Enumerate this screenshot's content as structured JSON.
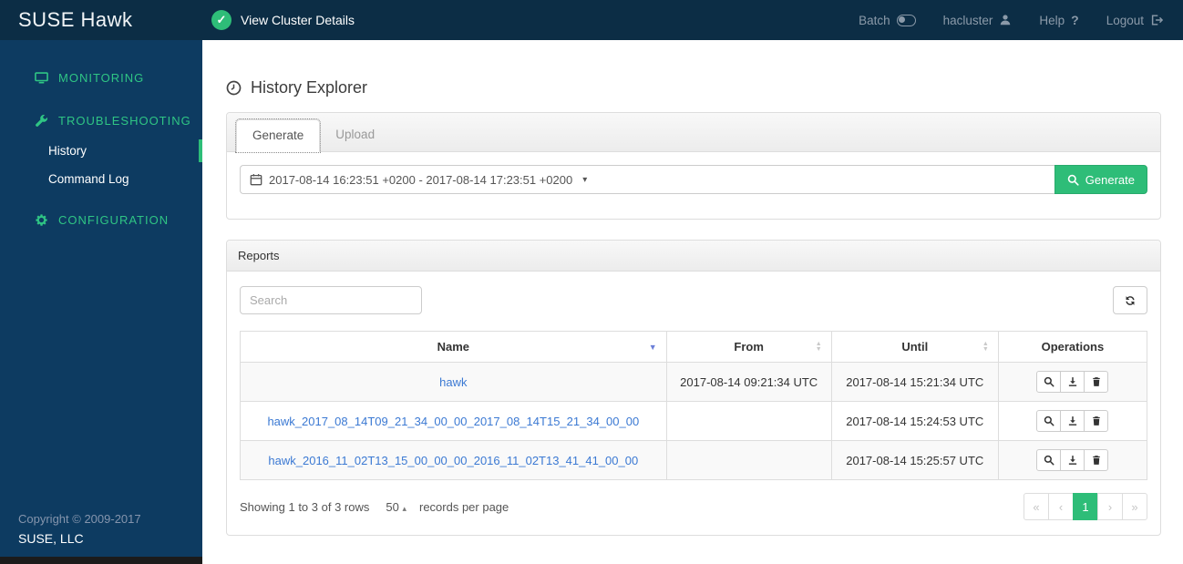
{
  "topbar": {
    "brand": "SUSE Hawk",
    "cluster_status": "View Cluster Details",
    "menu": [
      {
        "label": "Batch",
        "icon": "batch-toggle-icon"
      },
      {
        "label": "hacluster",
        "icon": "user-icon"
      },
      {
        "label": "Help",
        "icon": "question-icon"
      },
      {
        "label": "Logout",
        "icon": "logout-icon"
      }
    ]
  },
  "sidebar": {
    "sections": [
      {
        "label": "MONITORING",
        "icon": "monitor-icon",
        "items": []
      },
      {
        "label": "TROUBLESHOOTING",
        "icon": "wrench-icon",
        "items": [
          {
            "label": "History",
            "active": true
          },
          {
            "label": "Command Log",
            "active": false
          }
        ]
      },
      {
        "label": "CONFIGURATION",
        "icon": "gear-icon",
        "items": []
      }
    ],
    "footer": {
      "copyright": "Copyright © 2009-2017",
      "company": "SUSE, LLC"
    }
  },
  "main": {
    "title": "History Explorer",
    "tabs": [
      {
        "label": "Generate",
        "active": true
      },
      {
        "label": "Upload",
        "active": false
      }
    ],
    "generate_form": {
      "date_range": "2017-08-14 16:23:51 +0200 - 2017-08-14 17:23:51 +0200",
      "generate_button": "Generate"
    },
    "reports": {
      "panel_title": "Reports",
      "search_placeholder": "Search",
      "refresh_icon": "refresh-icon",
      "table": {
        "columns": [
          "Name",
          "From",
          "Until",
          "Operations"
        ],
        "sort": {
          "column": "Name",
          "direction": "desc"
        },
        "operations_icons": [
          "view-icon",
          "download-icon",
          "delete-icon"
        ],
        "rows": [
          {
            "name": "hawk",
            "from": "2017-08-14 09:21:34 UTC",
            "until": "2017-08-14 15:21:34 UTC"
          },
          {
            "name": "hawk_2017_08_14T09_21_34_00_00_2017_08_14T15_21_34_00_00",
            "from": "",
            "until": "2017-08-14 15:24:53 UTC"
          },
          {
            "name": "hawk_2016_11_02T13_15_00_00_00_2016_11_02T13_41_41_00_00",
            "from": "",
            "until": "2017-08-14 15:25:57 UTC"
          }
        ]
      },
      "pagination": {
        "summary": "Showing 1 to 3 of 3 rows",
        "page_size": "50",
        "records_label": "records per page",
        "pages": [
          "«",
          "‹",
          "1",
          "›",
          "»"
        ],
        "active_page": "1"
      }
    }
  },
  "colors": {
    "topbar_bg": "#0c2d45",
    "sidebar_bg": "#0d3b61",
    "accent_green": "#2ebd78",
    "sidebar_section_green": "#2fc584",
    "link_blue": "#3b79d3"
  }
}
